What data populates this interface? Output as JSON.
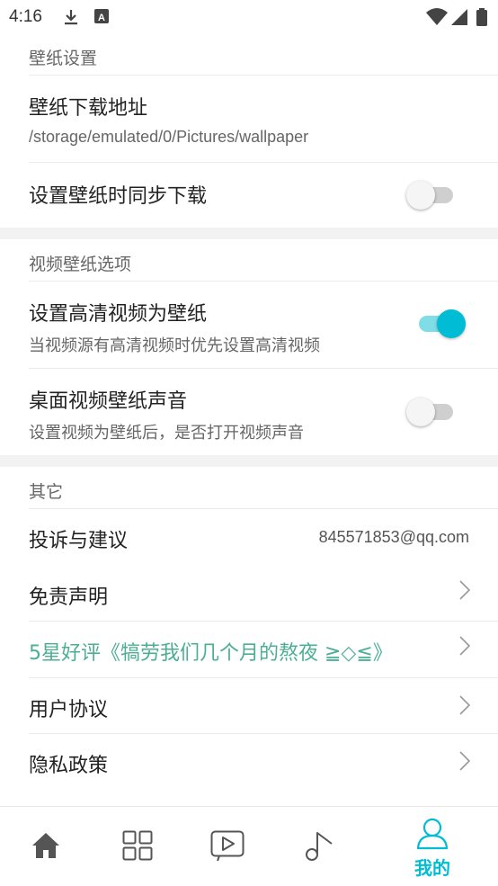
{
  "status_bar": {
    "time": "4:16"
  },
  "sections": {
    "wallpaper": {
      "title": "壁纸设置",
      "download_path": {
        "label": "壁纸下载地址",
        "value": "/storage/emulated/0/Pictures/wallpaper"
      },
      "sync_download": {
        "label": "设置壁纸时同步下载",
        "enabled": false
      }
    },
    "video": {
      "title": "视频壁纸选项",
      "hd_video": {
        "label": "设置高清视频为壁纸",
        "desc": "当视频源有高清视频时优先设置高清视频",
        "enabled": true
      },
      "video_sound": {
        "label": "桌面视频壁纸声音",
        "desc": "设置视频为壁纸后，是否打开视频声音",
        "enabled": false
      }
    },
    "other": {
      "title": "其它",
      "feedback": {
        "label": "投诉与建议",
        "value": "845571853@qq.com"
      },
      "disclaimer": {
        "label": "免责声明"
      },
      "rate": {
        "label": "5星好评《犒劳我们几个月的熬夜 ≧◇≦》",
        "color": "#4caf93"
      },
      "agreement": {
        "label": "用户协议"
      },
      "privacy": {
        "label": "隐私政策"
      }
    }
  },
  "bottom_nav": {
    "items": [
      {
        "icon": "home-icon"
      },
      {
        "icon": "grid-icon"
      },
      {
        "icon": "video-play-icon"
      },
      {
        "icon": "music-note-icon"
      },
      {
        "icon": "user-icon",
        "label": "我的",
        "active": true
      }
    ],
    "active_color": "#00bcd4",
    "inactive_color": "#555555"
  }
}
